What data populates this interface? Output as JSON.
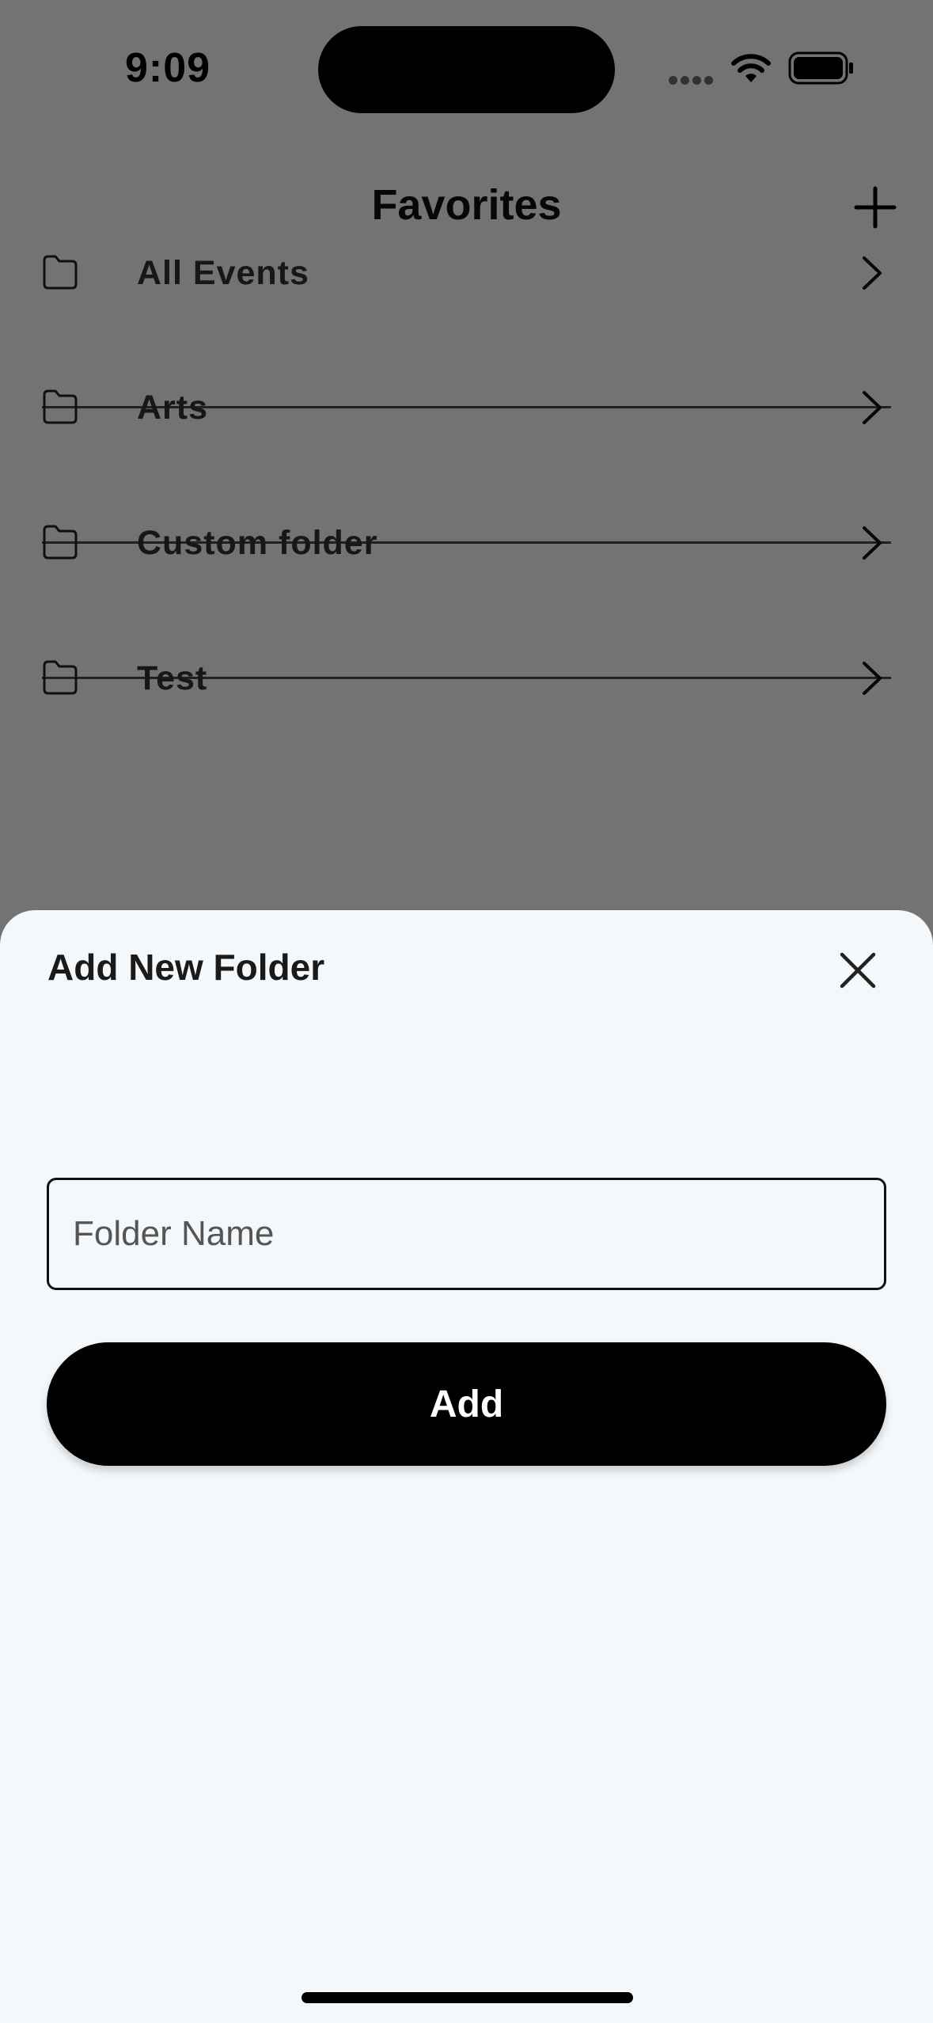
{
  "status_bar": {
    "time": "9:09"
  },
  "header": {
    "title": "Favorites",
    "add_icon": "plus-icon"
  },
  "folders": [
    {
      "label": "All Events",
      "icon": "folder-icon"
    },
    {
      "label": "Arts",
      "icon": "folder-icon"
    },
    {
      "label": "Custom folder",
      "icon": "folder-icon"
    },
    {
      "label": "Test",
      "icon": "folder-icon"
    }
  ],
  "sheet": {
    "title": "Add New Folder",
    "close_icon": "close-icon",
    "input_placeholder": "Folder Name",
    "input_value": "",
    "button_label": "Add"
  },
  "colors": {
    "overlay": "#000000",
    "sheet_background": "#f4f8fb",
    "button_background": "#000000",
    "button_text": "#ffffff"
  }
}
